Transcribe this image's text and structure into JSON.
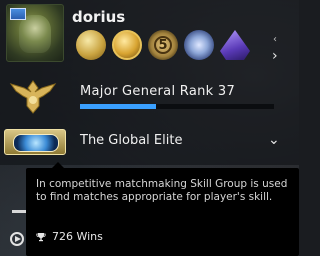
{
  "profile": {
    "username": "dorius"
  },
  "medals": [
    {
      "icon": "coin-icon"
    },
    {
      "icon": "gold-wreath-coin-icon"
    },
    {
      "icon": "five-year-coin-icon",
      "label": "5"
    },
    {
      "icon": "blue-star-medal-icon"
    },
    {
      "icon": "purple-operation-medal-icon"
    }
  ],
  "rank": {
    "title": "Major General Rank 37",
    "xp_progress_percent": 39,
    "accent_color": "#3aa0ff"
  },
  "skill_group": {
    "name": "The Global Elite"
  },
  "tooltip": {
    "text": "In competitive matchmaking Skill Group is used to find matches appropriate for player's skill.",
    "wins": "726 Wins"
  }
}
